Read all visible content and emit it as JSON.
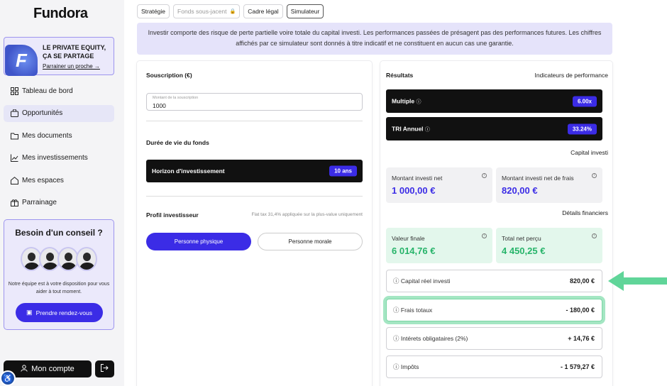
{
  "app": {
    "logo": "Fundora"
  },
  "promo": {
    "title": "LE PRIVATE EQUITY, ÇA SE PARTAGE",
    "link": "Parrainer un proche →",
    "logo_letter": "F"
  },
  "sidebar": {
    "items": [
      {
        "label": "Tableau de bord",
        "icon": "dashboard-icon"
      },
      {
        "label": "Opportunités",
        "icon": "bag-icon"
      },
      {
        "label": "Mes documents",
        "icon": "folder-icon"
      },
      {
        "label": "Mes investissements",
        "icon": "chart-icon"
      },
      {
        "label": "Mes espaces",
        "icon": "home-icon"
      },
      {
        "label": "Parrainage",
        "icon": "gift-icon"
      }
    ]
  },
  "help": {
    "title": "Besoin d'un conseil ?",
    "text": "Notre équipe est à votre disposition pour vous aider à tout moment.",
    "button": "Prendre rendez-vous"
  },
  "account": {
    "label": "Mon compte"
  },
  "tabs": [
    {
      "label": "Stratégie",
      "state": "normal"
    },
    {
      "label": "Fonds sous-jacent",
      "state": "disabled"
    },
    {
      "label": "Cadre légal",
      "state": "normal"
    },
    {
      "label": "Simulateur",
      "state": "active"
    }
  ],
  "disclaimer": "Investir comporte des risque de perte partielle voire totale du capital investi. Les performances passées de présagent pas des performances futures. Les chiffres affichés par ce simulateur sont donnés à titre indicatif et ne constituent en aucun cas une garantie.",
  "left": {
    "subscription_title": "Souscription (€)",
    "amount_label": "Montant de la souscription",
    "amount_value": "1000",
    "duration_title": "Durée de vie du fonds",
    "horizon_label": "Horizon d'investissement",
    "horizon_value": "10 ans",
    "profile_title": "Profil investisseur",
    "profile_note": "Flat tax 31,4% appliquée sur la plus-value uniquement",
    "btn_physical": "Personne physique",
    "btn_moral": "Personne morale"
  },
  "right": {
    "results_title": "Résultats",
    "perf_title": "Indicateurs de performance",
    "multiple_label": "Multiple",
    "multiple_value": "6.00x",
    "tri_label": "TRI Annuel",
    "tri_value": "33.24%",
    "capital_title": "Capital investi",
    "invested_label": "Montant investi net",
    "invested_value": "1 000,00 €",
    "invested_fees_label": "Montant investi net de frais",
    "invested_fees_value": "820,00 €",
    "details_title": "Détails financiers",
    "final_label": "Valeur finale",
    "final_value": "6 014,76 €",
    "total_label": "Total net perçu",
    "total_value": "4 450,25 €",
    "rows": [
      {
        "label": "Capital réel investi",
        "value": "820,00 €"
      },
      {
        "label": "Frais totaux",
        "value": "- 180,00 €"
      },
      {
        "label": "Intérets obligataires (2%)",
        "value": "+ 14,76 €"
      },
      {
        "label": "Impôts",
        "value": "- 1 579,27 €"
      }
    ]
  },
  "colors": {
    "accent": "#3b2ce6",
    "green": "#27b46a",
    "highlight": "#a4e6c3"
  }
}
